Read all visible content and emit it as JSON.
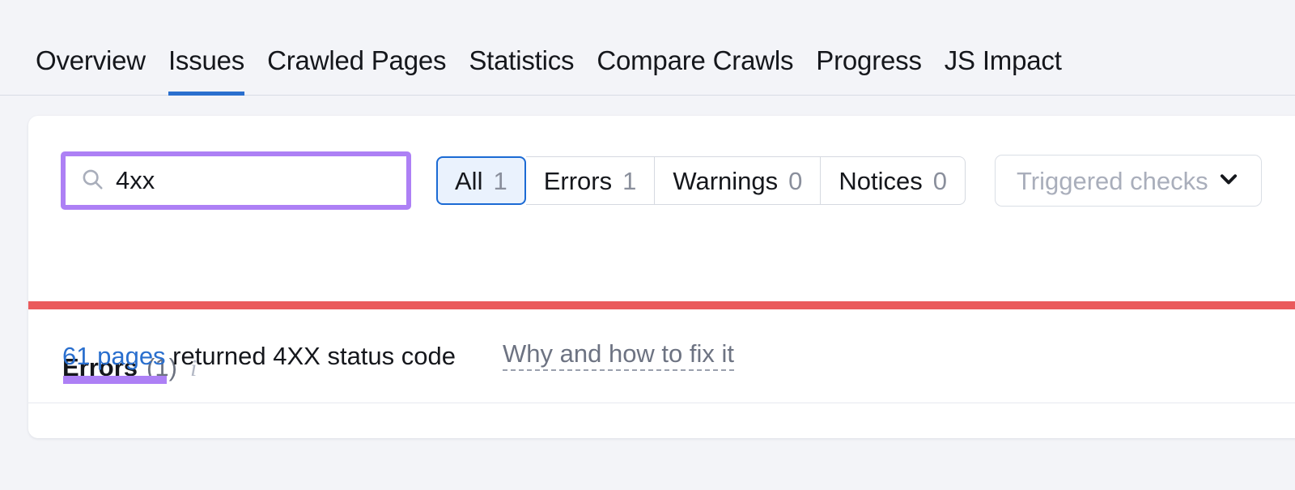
{
  "page": {
    "background_color": "#f3f4f8",
    "accent_blue": "#2a6fce",
    "accent_purple": "#ad80f5",
    "error_red": "#ea5a5c"
  },
  "tabs": [
    {
      "label": "Overview",
      "active": false
    },
    {
      "label": "Issues",
      "active": true
    },
    {
      "label": "Crawled Pages",
      "active": false
    },
    {
      "label": "Statistics",
      "active": false
    },
    {
      "label": "Compare Crawls",
      "active": false
    },
    {
      "label": "Progress",
      "active": false
    },
    {
      "label": "JS Impact",
      "active": false
    }
  ],
  "search": {
    "value": "4xx",
    "placeholder": "",
    "search_icon": "search-icon",
    "clear_icon": "close-icon",
    "highlight_color": "#ad80f5"
  },
  "filters": [
    {
      "label": "All",
      "count": "1",
      "selected": true
    },
    {
      "label": "Errors",
      "count": "1",
      "selected": false
    },
    {
      "label": "Warnings",
      "count": "0",
      "selected": false
    },
    {
      "label": "Notices",
      "count": "0",
      "selected": false
    }
  ],
  "dropdown": {
    "placeholder": "Triggered checks",
    "chevron_icon": "chevron-down-icon"
  },
  "section": {
    "title": "Errors",
    "count": "(1)",
    "info_icon": "info-icon",
    "info_glyph": "i"
  },
  "issues": [
    {
      "link_text": "61 pages",
      "rest_text": " returned 4XX status code",
      "fix_link": "Why and how to fix it",
      "severity_color": "#ea5a5c"
    }
  ]
}
